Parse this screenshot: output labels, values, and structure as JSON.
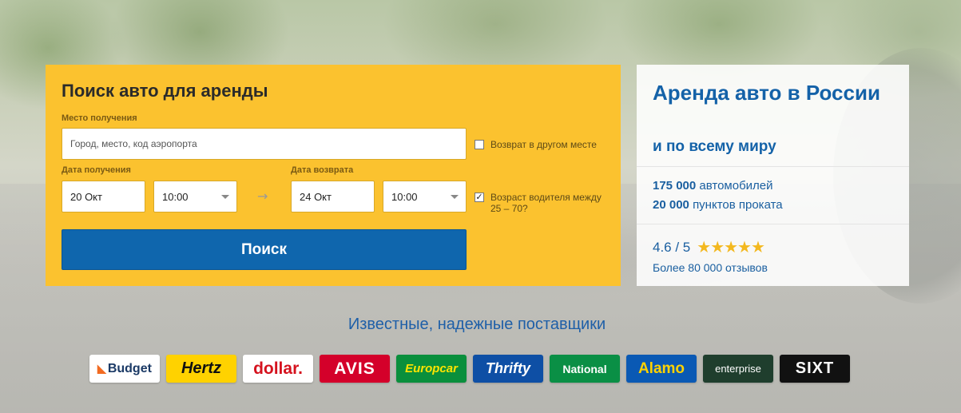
{
  "search": {
    "title": "Поиск авто для аренды",
    "pickup_label": "Место получения",
    "pickup_placeholder": "Город, место, код аэропорта",
    "return_other_label": "Возврат в другом месте",
    "pickup_date_label": "Дата получения",
    "pickup_date": "20 Окт",
    "pickup_time": "10:00",
    "return_date_label": "Дата возврата",
    "return_date": "24 Окт",
    "return_time": "10:00",
    "age_label": "Возраст водителя между 25 – 70?",
    "age_checked": true,
    "return_other_checked": false,
    "button": "Поиск"
  },
  "info": {
    "title": "Аренда авто в России",
    "subtitle": "и по всему миру",
    "stats": [
      {
        "value": "175 000",
        "text": "автомобилей"
      },
      {
        "value": "20 000",
        "text": "пунктов проката"
      }
    ],
    "rating": "4.6 / 5",
    "rating_value": 4.6,
    "stars": "★★★★★",
    "reviews": "Более 80 000 отзывов"
  },
  "suppliers": {
    "title": "Известные, надежные поставщики",
    "logos": [
      "Budget",
      "Hertz",
      "dollar.",
      "AVIS",
      "Europcar",
      "Thrifty",
      "National",
      "Alamo",
      "enterprise",
      "SIXT"
    ]
  },
  "colors": {
    "panel_yellow": "#fbc22f",
    "button_blue": "#0f66ad",
    "text_blue": "#1462a8",
    "star_gold": "#f3b81f"
  }
}
